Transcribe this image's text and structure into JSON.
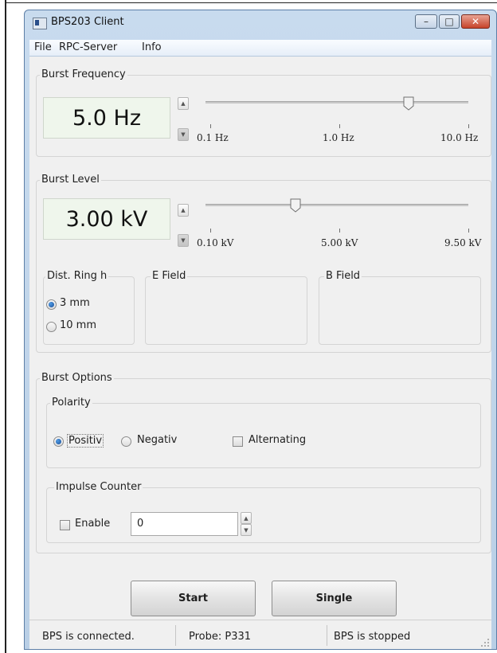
{
  "window": {
    "title": "BPS203 Client",
    "icons": {
      "app": "app-window-icon",
      "minimize": "minimize-icon",
      "maximize": "maximize-icon",
      "close": "close-icon"
    }
  },
  "menu": [
    "File",
    "RPC-Server",
    "Info"
  ],
  "burst_frequency": {
    "title": "Burst Frequency",
    "display": "5.0 Hz",
    "slider_min_label": "0.1 Hz",
    "slider_mid_label": "1.0 Hz",
    "slider_max_label": "10.0 Hz",
    "slider_position_fraction": 0.77
  },
  "burst_level": {
    "title": "Burst Level",
    "display": "3.00 kV",
    "slider_min_label": "0.10 kV",
    "slider_mid_label": "5.00 kV",
    "slider_max_label": "9.50 kV",
    "slider_position_fraction": 0.33,
    "dist_ring": {
      "title": "Dist. Ring h",
      "options": [
        "3 mm",
        "10 mm"
      ],
      "selected": "3 mm"
    },
    "e_field_title": "E Field",
    "b_field_title": "B Field"
  },
  "burst_options": {
    "title": "Burst Options",
    "polarity": {
      "title": "Polarity",
      "positive_label": "Positiv",
      "negative_label": "Negativ",
      "alternating_label": "Alternating",
      "selected": "Positiv",
      "alternating_checked": false
    },
    "impulse_counter": {
      "title": "Impulse Counter",
      "enable_label": "Enable",
      "enable_checked": false,
      "value": "0"
    }
  },
  "buttons": {
    "start": "Start",
    "single": "Single"
  },
  "status": {
    "connection": "BPS is connected.",
    "probe": "Probe: P331",
    "state": "BPS is stopped"
  },
  "colors": {
    "lcd_bg": "#eff6ec",
    "title_bar": "#c8dbee",
    "radio_dot": "#1b4e96",
    "close_button": "#c7432a"
  }
}
